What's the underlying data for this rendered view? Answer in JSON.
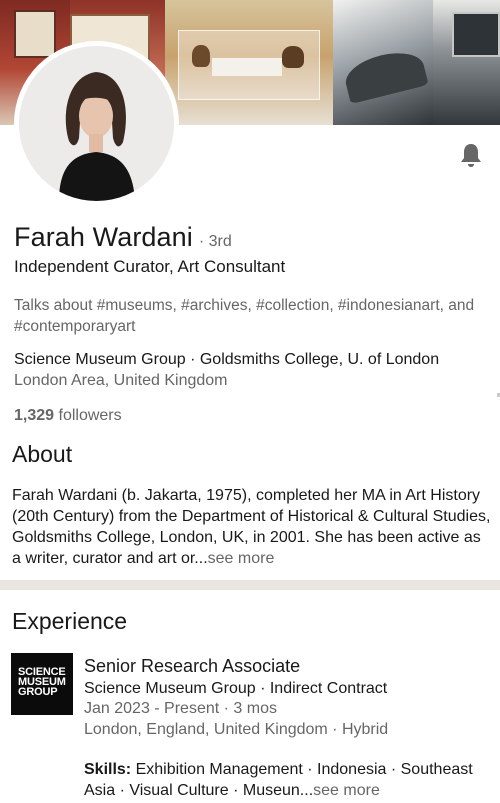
{
  "profile": {
    "name": "Farah Wardani",
    "degree": "· 3rd",
    "headline": "Independent Curator, Art Consultant",
    "talks_about": "Talks about #museums, #archives, #collection, #indonesianart, and #contemporaryart",
    "education": "Science Museum Group · Goldsmiths College, U. of London",
    "location": "London Area, United Kingdom",
    "followers_count": "1,329",
    "followers_label": "followers"
  },
  "about": {
    "title": "About",
    "text": "Farah Wardani (b. Jakarta, 1975), completed her MA in Art History (20th Century) from the Department of Historical & Cultural Studies, Goldsmiths College, London, UK, in 2001. She has been active as a writer, curator and art or...",
    "see_more": "see more"
  },
  "experience": {
    "title": "Experience",
    "logo_lines": [
      "SCIENCE",
      "MUSEUM",
      "GROUP"
    ],
    "job_title": "Senior Research Associate",
    "company": "Science Museum Group · Indirect Contract",
    "dates": "Jan 2023 - Present · 3 mos",
    "location": "London, England, United Kingdom · Hybrid",
    "skills_label": "Skills:",
    "skills_text": "Exhibition Management · Indonesia · Southeast Asia · Visual Culture · Museun...",
    "see_more": "see more"
  },
  "icons": {
    "notification": "bell-icon",
    "cover": "cover-photo",
    "avatar": "profile-photo"
  },
  "colors": {
    "text_primary": "#191919",
    "text_secondary": "#666666",
    "divider": "#e9e5df",
    "logo_bg": "#0b0b0b"
  }
}
